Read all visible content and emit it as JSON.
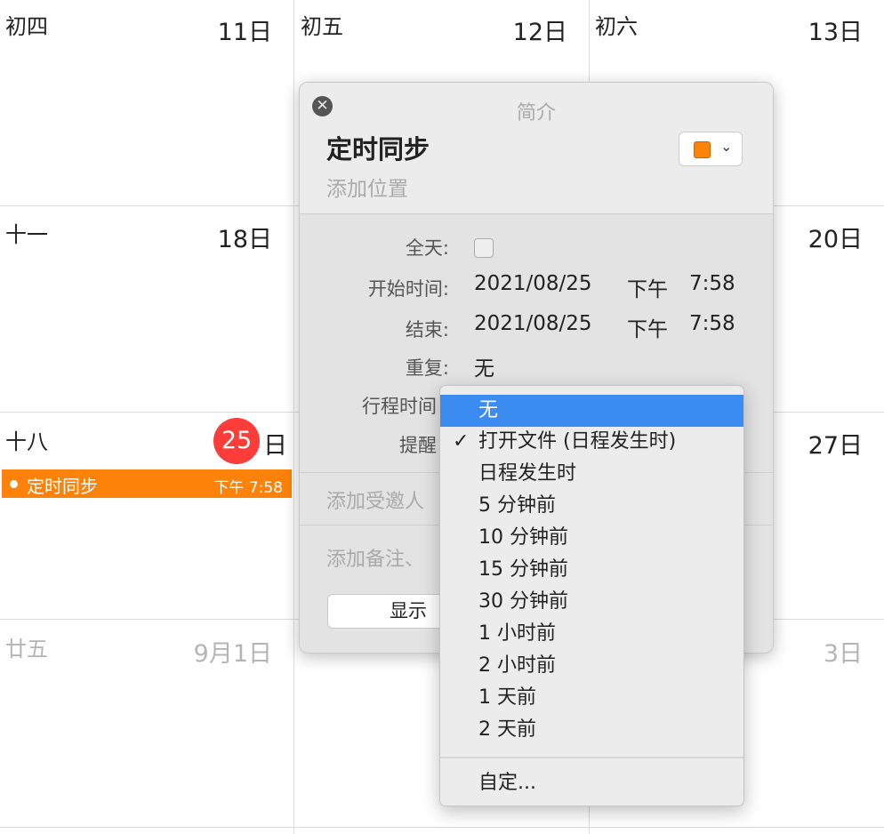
{
  "calendar": {
    "rows": [
      [
        {
          "lunar": "初四",
          "day": "11日"
        },
        {
          "lunar": "初五",
          "day": "12日"
        },
        {
          "lunar": "初六",
          "day": "13日"
        }
      ],
      [
        {
          "lunar": "十一",
          "day": "18日"
        },
        {
          "lunar": "",
          "day": ""
        },
        {
          "lunar": "",
          "day": "20日"
        }
      ],
      [
        {
          "lunar": "十八",
          "day": "日",
          "today": "25"
        },
        {
          "lunar": "",
          "day": ""
        },
        {
          "lunar": "",
          "day": "27日"
        }
      ],
      [
        {
          "lunar": "廿五",
          "day": "9月1日"
        },
        {
          "lunar": "",
          "day": ""
        },
        {
          "lunar": "",
          "day": "3日"
        }
      ]
    ],
    "event": {
      "title": "定时同步",
      "time": "下午 7:58",
      "color": "#fd8209"
    },
    "today_color": "#fc3d39"
  },
  "popover": {
    "header": "简介",
    "title": "定时同步",
    "location_placeholder": "添加位置",
    "color_swatch": "#fd8209",
    "fields": {
      "allday_label": "全天:",
      "start_label": "开始时间:",
      "start_date": "2021/08/25",
      "start_ampm": "下午",
      "start_time": "7:58",
      "end_label": "结束:",
      "end_date": "2021/08/25",
      "end_ampm": "下午",
      "end_time": "7:58",
      "repeat_label": "重复:",
      "repeat_value": "无",
      "travel_label": "行程时间",
      "alert_label": "提醒"
    },
    "invitees_placeholder": "添加受邀人",
    "notes_placeholder": "添加备注、",
    "show_button": "显示"
  },
  "alert_menu": {
    "items": [
      "无",
      "打开文件 (日程发生时)",
      "日程发生时",
      "5 分钟前",
      "10 分钟前",
      "15 分钟前",
      "30 分钟前",
      "1 小时前",
      "2 小时前",
      "1 天前",
      "2 天前"
    ],
    "checked_index": 1,
    "highlight_index": 0,
    "checkmark": "✓",
    "custom": "自定..."
  }
}
